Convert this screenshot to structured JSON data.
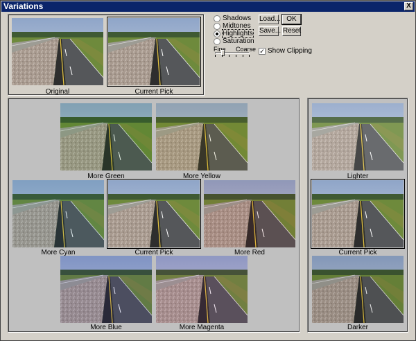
{
  "window": {
    "title": "Variations",
    "close_glyph": "X"
  },
  "adjust_options": [
    {
      "label": "Shadows",
      "selected": false
    },
    {
      "label": "Midtones",
      "selected": false
    },
    {
      "label": "Highlights",
      "selected": true
    },
    {
      "label": "Saturation",
      "selected": false
    }
  ],
  "buttons": {
    "load": "Load...",
    "save": "Save...",
    "ok": "OK",
    "reset": "Reset"
  },
  "slider": {
    "min_label": "Fine",
    "max_label": "Coarse",
    "value_fraction": 0.2
  },
  "show_clipping": {
    "label": "Show Clipping",
    "checked": true,
    "glyph": "✓"
  },
  "top_thumbs": {
    "original": "Original",
    "current_pick": "Current Pick"
  },
  "color_variations": {
    "more_green": "More Green",
    "more_yellow": "More Yellow",
    "more_cyan": "More Cyan",
    "current_pick": "Current Pick",
    "more_red": "More Red",
    "more_blue": "More Blue",
    "more_magenta": "More Magenta"
  },
  "brightness_variations": {
    "lighter": "Lighter",
    "current_pick": "Current Pick",
    "darker": "Darker"
  },
  "icons": {
    "close": "close-icon",
    "check": "check-icon"
  }
}
